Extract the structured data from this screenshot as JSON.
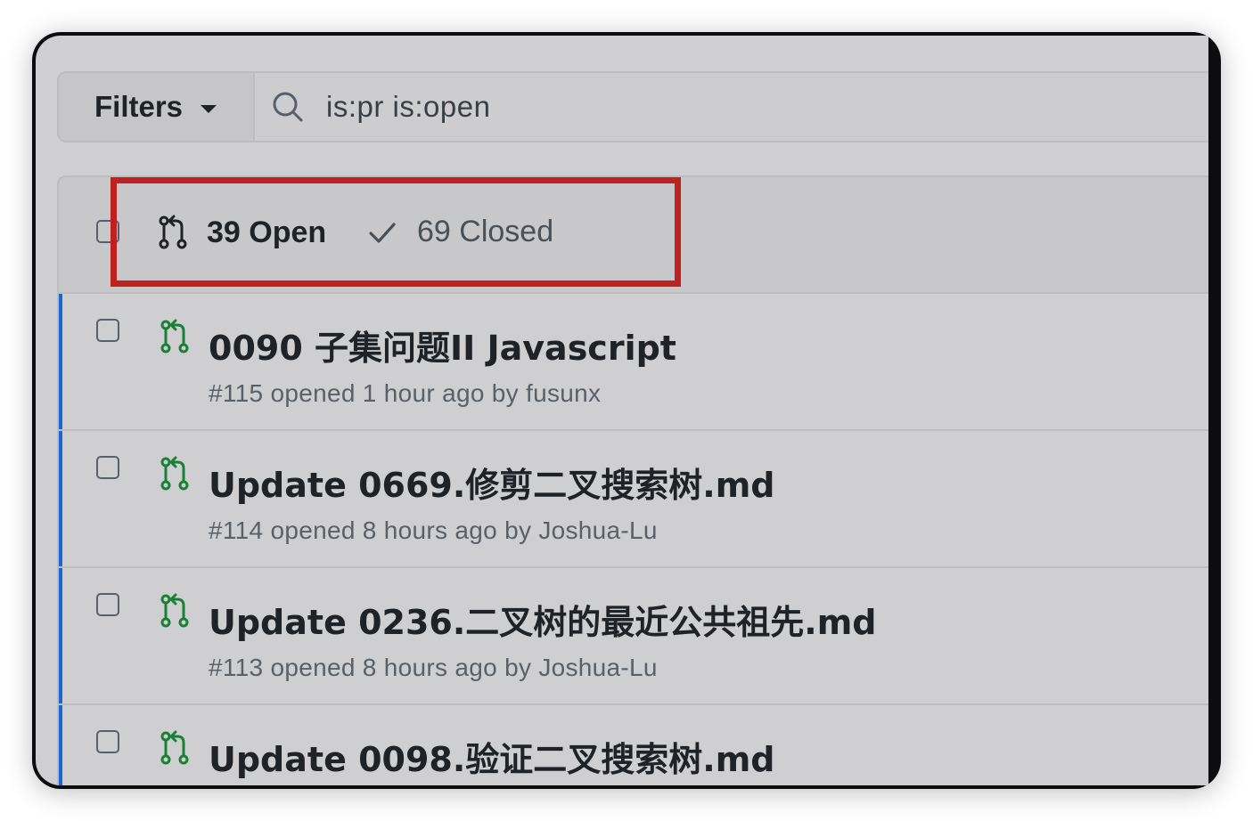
{
  "filter_bar": {
    "filters_label": "Filters",
    "search_value": "is:pr is:open"
  },
  "tabs": {
    "open_label": "39 Open",
    "closed_label": "69 Closed"
  },
  "pull_requests": [
    {
      "title": "0090 子集问题II Javascript",
      "meta": "#115 opened 1 hour ago by fusunx"
    },
    {
      "title": "Update 0669.修剪二叉搜索树.md",
      "meta": "#114 opened 8 hours ago by Joshua-Lu"
    },
    {
      "title": "Update 0236.二叉树的最近公共祖先.md",
      "meta": "#113 opened 8 hours ago by Joshua-Lu"
    },
    {
      "title": "Update 0098.验证二叉搜索树.md",
      "meta": ""
    }
  ],
  "colors": {
    "open_icon_green": "#1a7f37",
    "highlight_red": "#c0201f",
    "row_accent_blue": "#1a66d6"
  }
}
